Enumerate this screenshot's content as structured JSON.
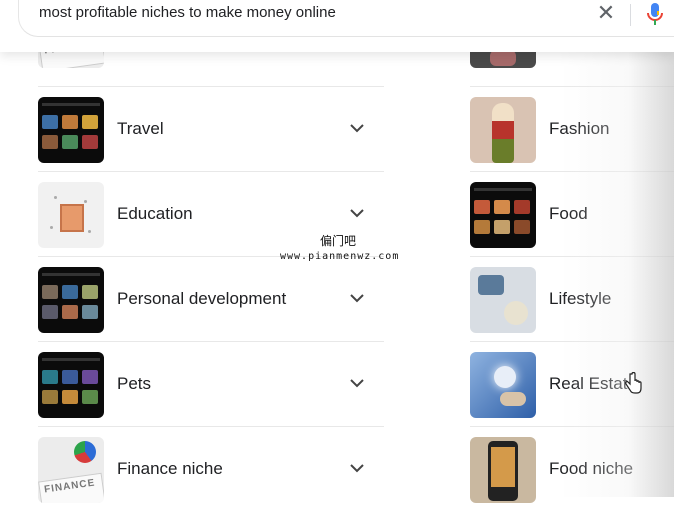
{
  "search": {
    "query": "most profitable niches to make money online"
  },
  "icons": {
    "clear": "close-icon",
    "mic": "microphone-icon",
    "chevron": "chevron-down-icon",
    "cursor": "hand-pointer-icon"
  },
  "left_list": {
    "top_partial_thumb_text": "FINANCE",
    "items": [
      {
        "label": "Travel"
      },
      {
        "label": "Education"
      },
      {
        "label": "Personal development"
      },
      {
        "label": "Pets"
      },
      {
        "label": "Finance niche"
      }
    ],
    "finance_thumb_text": "FINANCE"
  },
  "right_list": {
    "items": [
      {
        "label": "Fashion"
      },
      {
        "label": "Food"
      },
      {
        "label": "Lifestyle"
      },
      {
        "label": "Real Estat"
      },
      {
        "label": "Food niche"
      }
    ]
  },
  "watermark": {
    "line1": "偏门吧",
    "line2": "www.pianmenwz.com"
  },
  "colors": {
    "text": "#202124",
    "mic_blue": "#4285f4",
    "mic_red": "#ea4335",
    "mic_yellow": "#fbbc05",
    "mic_green": "#34a853"
  }
}
